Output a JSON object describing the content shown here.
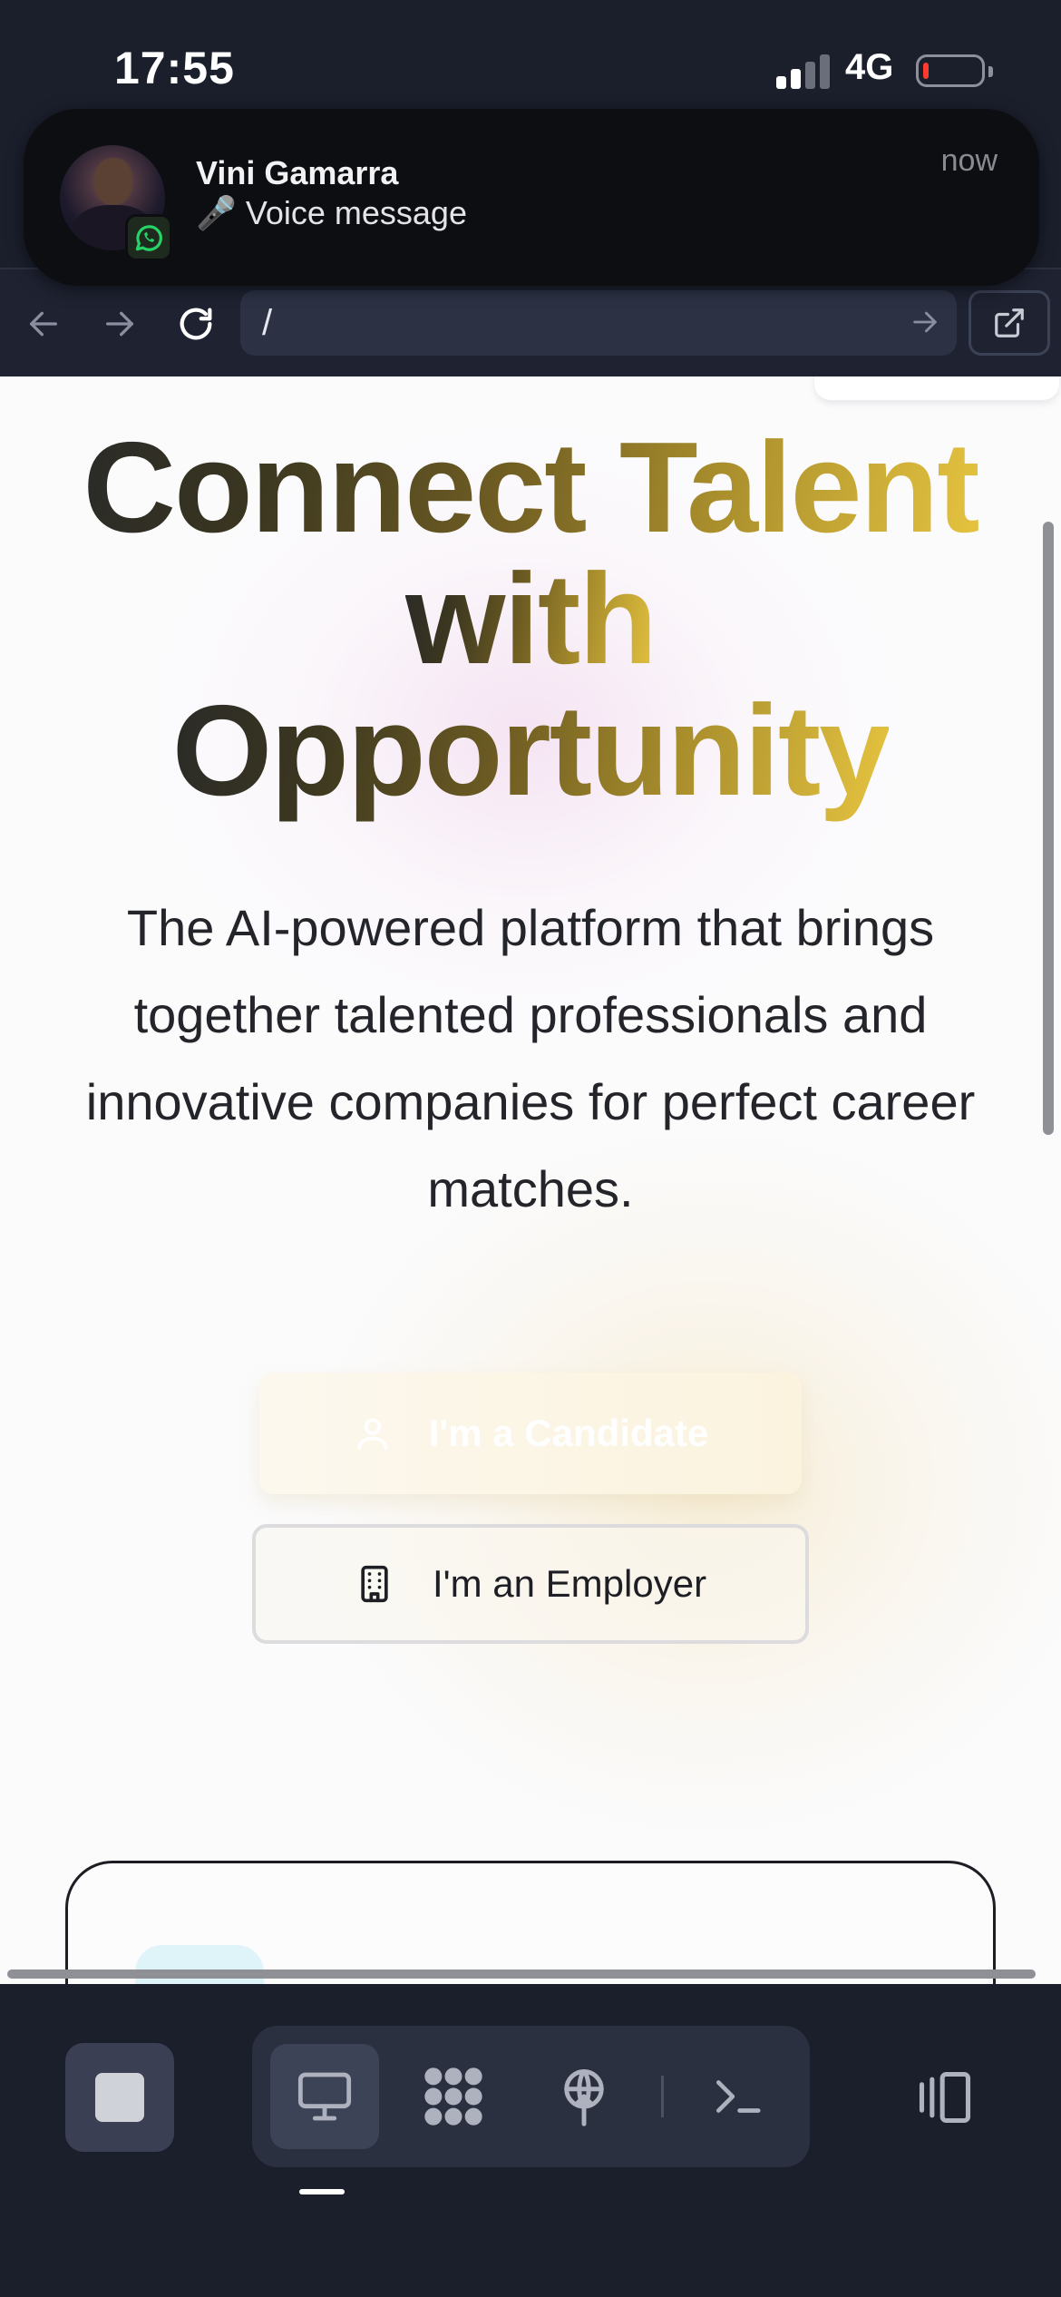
{
  "status_bar": {
    "time": "17:55",
    "network": "4G",
    "battery_level": 0.1,
    "battery_color": "#ff3b30"
  },
  "notification": {
    "sender": "Vini Gamarra",
    "message": "🎤 Voice message",
    "time": "now",
    "app_icon": "whatsapp-icon"
  },
  "browser": {
    "back_icon": "arrow-left-icon",
    "forward_icon": "arrow-right-icon",
    "reload_icon": "reload-icon",
    "url": "/",
    "go_icon": "arrow-right-icon",
    "open_external_icon": "external-link-icon"
  },
  "hero": {
    "title_line1": "Connect Talent",
    "title_line2": "with",
    "title_line3": "Opportunity",
    "subtitle": "The AI-powered platform that brings together talented professionals and innovative companies for perfect career matches.",
    "candidate_button": "I'm a Candidate",
    "candidate_icon": "user-icon",
    "employer_button": "I'm an Employer",
    "employer_icon": "building-icon",
    "gradient_colors": [
      "#2a2a28",
      "#6b5a22",
      "#e6c440"
    ]
  },
  "toolbar": {
    "stop_icon": "stop-icon",
    "modes": [
      {
        "icon": "monitor-icon",
        "active": true
      },
      {
        "icon": "apps-grid-icon",
        "active": false
      },
      {
        "icon": "network-tower-icon",
        "active": false
      },
      {
        "icon": "terminal-icon",
        "active": false
      }
    ],
    "panel_icon": "side-panel-icon"
  }
}
